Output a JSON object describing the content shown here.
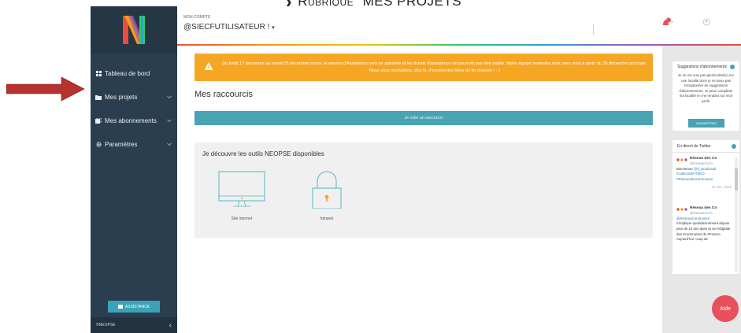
{
  "heading": {
    "chevron": "❯",
    "text_lead": "Rubrique",
    "text_main": "“MES PROJETS”"
  },
  "sidebar": {
    "items": [
      {
        "label": "Tableau de bord",
        "icon": "dashboard-icon"
      },
      {
        "label": "Mes projets",
        "icon": "folder-icon"
      },
      {
        "label": "Mes abonnements",
        "icon": "subscriptions-icon"
      },
      {
        "label": "Paramètres",
        "icon": "gear-icon"
      }
    ],
    "assistance_label": "ASSISTANCE",
    "footer_label": "©NEOPSE",
    "collapse_glyph": "‹"
  },
  "topbar": {
    "account_label": "MON COMPTE",
    "account_name": "@SIECFUTILISATEUR !",
    "account_caret": "▾",
    "notif_count": "2"
  },
  "main": {
    "alert_text": "Du lundi 17 décembre au mardi 25 décembre inclus, le service d'Assistance sera en astreinte et les tickets d'assistance ne pourront pas être traités. Notre équipe reviendra donc vers vous à partir du 26 décembre prochain. Nous vous souhaitons, d'ici là, d'excellentes fêtes de fin d'année ! :-)",
    "shortcuts_title": "Mes raccourcis",
    "create_shortcut_label": "Je crée un raccourci",
    "tools_title": "Je découvre les outils NEOPSE disponibles",
    "tools": [
      {
        "label": "Site internet"
      },
      {
        "label": "Intranet"
      }
    ]
  },
  "right": {
    "suggestions_title": "Suggestions d'abonnements",
    "suggestions_body": "Je ne me suis pas géolocalisé(e) sur une localité donc je ne peux pas réceptionner de suggestions d'abonnements. Je peux compléter ma localité en me rendant sur mon profil.",
    "params_label": "PARAMÈTRES",
    "twitter_title": "En direct de Twitter",
    "tweets": [
      {
        "name": "Réseau des Co",
        "handle": "@ReseauCom",
        "text": "Bienvenue",
        "link": "@d_Boulicault #collectivité #SEO #Réseaudescommunes",
        "date": "12 déc. 2018"
      },
      {
        "name": "Réseau des Co",
        "handle": "@ReseauCom",
        "link": "@ReseauCommunes",
        "text": "s'implique quotidiennement depuis plus de 10 ans dans la vie #digitale des #communes de #France. Aujourd'hui, coup de"
      }
    ]
  },
  "aide_label": "Aide",
  "colors": {
    "sidebar": "#2b3e50",
    "alert": "#f5a623",
    "teal": "#48a3b3",
    "aide": "#e8505b",
    "annotation_arrow": "#b5322e"
  }
}
